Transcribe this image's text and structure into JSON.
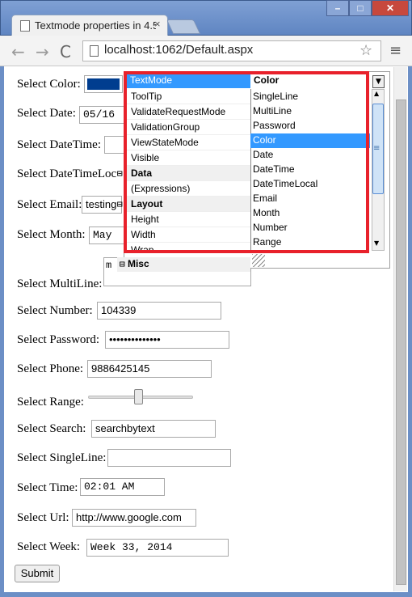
{
  "window": {
    "tab_title": "Textmode properties in 4.5",
    "tab_close": "×",
    "min": "–",
    "max": "□",
    "close": "✕",
    "url": "localhost:1062/Default.aspx"
  },
  "icons": {
    "back": "←",
    "forward": "→",
    "reload": "C",
    "star": "☆",
    "menu": "≡"
  },
  "form": {
    "color_label": "Select Color:",
    "color_value": "#003d8f",
    "date_label": "Select Date:",
    "date_value": "05/16",
    "datetime_label": "Select DateTime:",
    "datetimelocal_label": "Select DateTimeLoc",
    "email_label": "Select Email:",
    "email_value": "testing",
    "month_label": "Select Month:",
    "month_value": "May",
    "multiline_label": "Select MultiLine:",
    "multiline_value": "m",
    "number_label": "Select Number:",
    "number_value": "104339",
    "password_label": "Select Password:",
    "password_value": "••••••••••••••",
    "phone_label": "Select Phone:",
    "phone_value": "9886425145",
    "range_label": "Select Range:",
    "range_fraction": 0.48,
    "search_label": "Select Search:",
    "search_value": "searchbytext",
    "singleline_label": "Select SingleLine:",
    "singleline_value": "",
    "time_label": "Select Time:",
    "time_value": "02:01 AM",
    "url_label": "Select Url:",
    "url_value": "http://www.google.com",
    "week_label": "Select Week:",
    "week_value": "Week 33, 2014",
    "submit": "Submit"
  },
  "property_grid": {
    "selected_property": "TextMode",
    "selected_value": "Color",
    "rows": [
      {
        "label": "ToolTip",
        "category": false
      },
      {
        "label": "ValidateRequestMode",
        "category": false
      },
      {
        "label": "ValidationGroup",
        "category": false
      },
      {
        "label": "ViewStateMode",
        "category": false
      },
      {
        "label": "Visible",
        "category": false
      },
      {
        "label": "Data",
        "category": true
      },
      {
        "label": "(Expressions)",
        "category": false
      },
      {
        "label": "Layout",
        "category": true
      },
      {
        "label": "Height",
        "category": false
      },
      {
        "label": "Width",
        "category": false
      },
      {
        "label": "Wrap",
        "category": false
      }
    ],
    "options": [
      "SingleLine",
      "MultiLine",
      "Password",
      "Color",
      "Date",
      "DateTime",
      "DateTimeLocal",
      "Email",
      "Month",
      "Number",
      "Range"
    ],
    "misc_label": "Misc",
    "collapse": "⊟",
    "dropdown_arrow": "▼",
    "scroll_up": "▲",
    "scroll_down": "▼",
    "grip": "≡"
  }
}
